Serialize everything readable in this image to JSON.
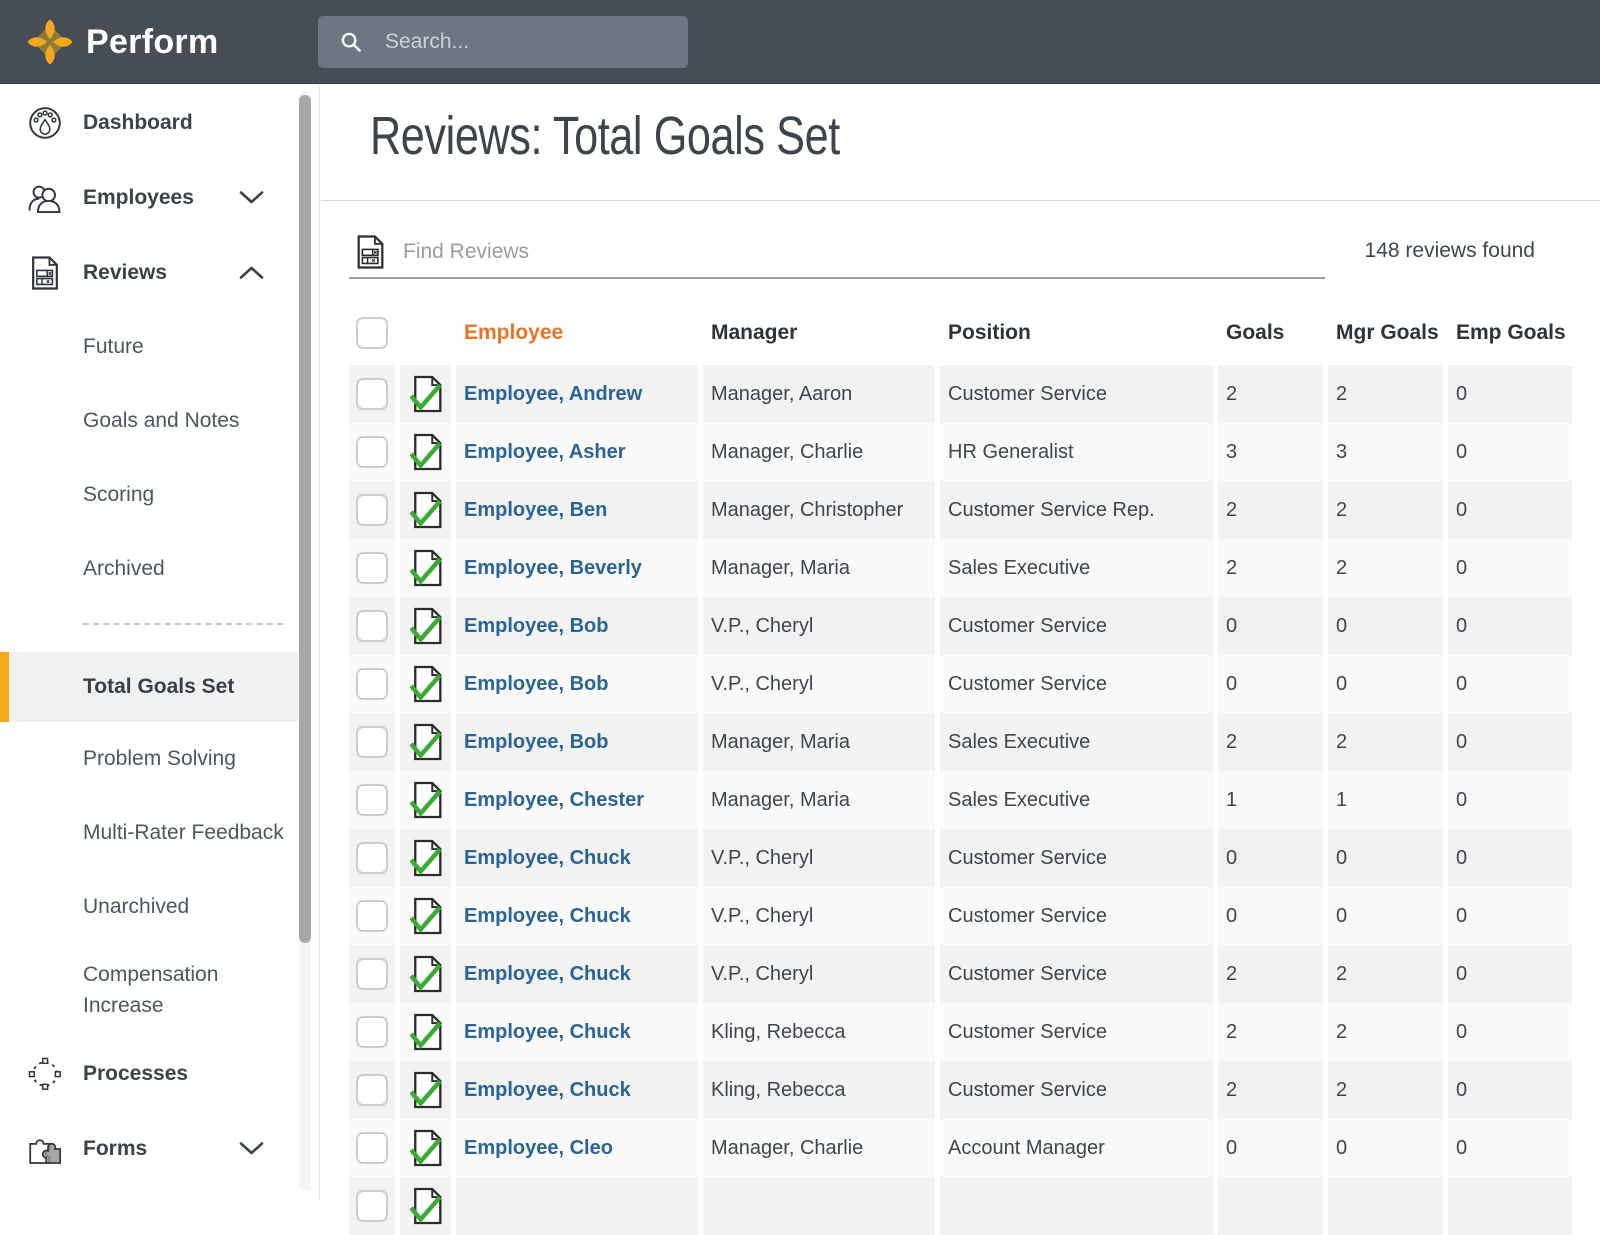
{
  "topbar": {
    "brand": "Perform",
    "search_placeholder": "Search..."
  },
  "sidebar": {
    "items": [
      {
        "type": "top",
        "icon": "dashboard",
        "label": "Dashboard"
      },
      {
        "type": "top",
        "icon": "employees",
        "label": "Employees",
        "chevron": "down"
      },
      {
        "type": "top",
        "icon": "reviews",
        "label": "Reviews",
        "chevron": "up"
      },
      {
        "type": "sub",
        "label": "Future"
      },
      {
        "type": "sub",
        "label": "Goals and Notes"
      },
      {
        "type": "sub",
        "label": "Scoring"
      },
      {
        "type": "sub",
        "label": "Archived"
      },
      {
        "type": "divider"
      },
      {
        "type": "sub",
        "label": "Total Goals Set",
        "selected": true
      },
      {
        "type": "sub",
        "label": "Problem Solving"
      },
      {
        "type": "sub",
        "label": "Multi-Rater Feedback"
      },
      {
        "type": "sub",
        "label": "Unarchived"
      },
      {
        "type": "sub",
        "label": "Compensation Increase",
        "two_line": true
      },
      {
        "type": "top",
        "icon": "processes",
        "label": "Processes"
      },
      {
        "type": "top",
        "icon": "forms",
        "label": "Forms",
        "chevron": "down"
      }
    ]
  },
  "page": {
    "title": "Reviews: Total Goals Set",
    "find_placeholder": "Find Reviews",
    "results_count": "148 reviews found"
  },
  "table": {
    "columns": [
      {
        "key": "employee",
        "label": "Employee",
        "sorted": true
      },
      {
        "key": "manager",
        "label": "Manager"
      },
      {
        "key": "position",
        "label": "Position"
      },
      {
        "key": "goals",
        "label": "Goals"
      },
      {
        "key": "mgr_goals",
        "label": "Mgr Goals"
      },
      {
        "key": "emp_goals",
        "label": "Emp Goals"
      }
    ],
    "rows": [
      {
        "employee": "Employee, Andrew",
        "manager": "Manager, Aaron",
        "position": "Customer Service",
        "goals": "2",
        "mgr_goals": "2",
        "emp_goals": "0"
      },
      {
        "employee": "Employee, Asher",
        "manager": "Manager, Charlie",
        "position": "HR Generalist",
        "goals": "3",
        "mgr_goals": "3",
        "emp_goals": "0"
      },
      {
        "employee": "Employee, Ben",
        "manager": "Manager, Christopher",
        "position": "Customer Service Rep.",
        "goals": "2",
        "mgr_goals": "2",
        "emp_goals": "0"
      },
      {
        "employee": "Employee, Beverly",
        "manager": "Manager, Maria",
        "position": "Sales Executive",
        "goals": "2",
        "mgr_goals": "2",
        "emp_goals": "0"
      },
      {
        "employee": "Employee, Bob",
        "manager": "V.P., Cheryl",
        "position": "Customer Service",
        "goals": "0",
        "mgr_goals": "0",
        "emp_goals": "0"
      },
      {
        "employee": "Employee, Bob",
        "manager": "V.P., Cheryl",
        "position": "Customer Service",
        "goals": "0",
        "mgr_goals": "0",
        "emp_goals": "0"
      },
      {
        "employee": "Employee, Bob",
        "manager": "Manager, Maria",
        "position": "Sales Executive",
        "goals": "2",
        "mgr_goals": "2",
        "emp_goals": "0"
      },
      {
        "employee": "Employee, Chester",
        "manager": "Manager, Maria",
        "position": "Sales Executive",
        "goals": "1",
        "mgr_goals": "1",
        "emp_goals": "0"
      },
      {
        "employee": "Employee, Chuck",
        "manager": "V.P., Cheryl",
        "position": "Customer Service",
        "goals": "0",
        "mgr_goals": "0",
        "emp_goals": "0"
      },
      {
        "employee": "Employee, Chuck",
        "manager": "V.P., Cheryl",
        "position": "Customer Service",
        "goals": "0",
        "mgr_goals": "0",
        "emp_goals": "0"
      },
      {
        "employee": "Employee, Chuck",
        "manager": "V.P., Cheryl",
        "position": "Customer Service",
        "goals": "2",
        "mgr_goals": "2",
        "emp_goals": "0"
      },
      {
        "employee": "Employee, Chuck",
        "manager": "Kling, Rebecca",
        "position": "Customer Service",
        "goals": "2",
        "mgr_goals": "2",
        "emp_goals": "0"
      },
      {
        "employee": "Employee, Chuck",
        "manager": "Kling, Rebecca",
        "position": "Customer Service",
        "goals": "2",
        "mgr_goals": "2",
        "emp_goals": "0"
      },
      {
        "employee": "Employee, Cleo",
        "manager": "Manager, Charlie",
        "position": "Account Manager",
        "goals": "0",
        "mgr_goals": "0",
        "emp_goals": "0"
      },
      {
        "employee": "",
        "manager": "",
        "position": "",
        "goals": "",
        "mgr_goals": "",
        "emp_goals": ""
      }
    ]
  },
  "colors": {
    "accent": "#E87424",
    "gold": "#F5A81C",
    "link": "#2A6496",
    "green": "#3BAA35",
    "topbar-bg": "#464D55",
    "search-bg": "#6D7681"
  }
}
